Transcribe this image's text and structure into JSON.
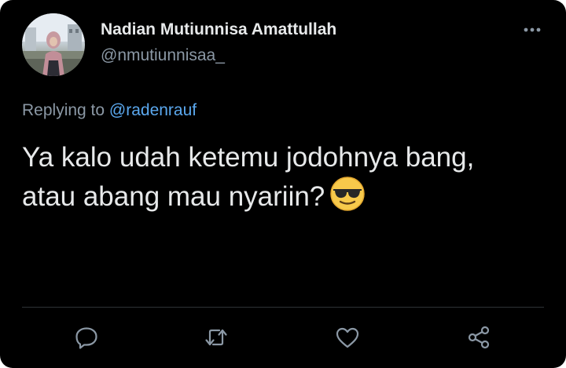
{
  "author": {
    "display_name": "Nadian Mutiunnisa Amattullah",
    "handle": "@nmutiunnisaa_"
  },
  "reply": {
    "prefix": "Replying to",
    "mention": "@radenrauf"
  },
  "tweet": {
    "line1": "Ya kalo udah ketemu jodohnya bang,",
    "line2": "atau abang mau nyariin?",
    "emoji": "smiling-face-with-sunglasses"
  },
  "actions": [
    "reply-icon",
    "retweet-icon",
    "like-icon",
    "share-icon"
  ],
  "colors": {
    "background": "#000000",
    "primary_text": "#e7e9ea",
    "secondary_text": "#8b98a5",
    "mention": "#5ba8ee",
    "icon": "#8b98a5",
    "divider": "#2f3336"
  }
}
